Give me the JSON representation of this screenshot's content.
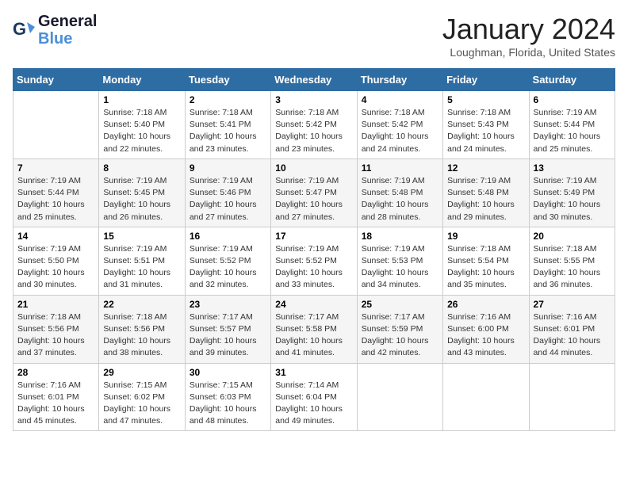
{
  "header": {
    "logo_line1": "General",
    "logo_line2": "Blue",
    "title": "January 2024",
    "subtitle": "Loughman, Florida, United States"
  },
  "days_of_week": [
    "Sunday",
    "Monday",
    "Tuesday",
    "Wednesday",
    "Thursday",
    "Friday",
    "Saturday"
  ],
  "weeks": [
    [
      {
        "day": "",
        "detail": ""
      },
      {
        "day": "1",
        "detail": "Sunrise: 7:18 AM\nSunset: 5:40 PM\nDaylight: 10 hours\nand 22 minutes."
      },
      {
        "day": "2",
        "detail": "Sunrise: 7:18 AM\nSunset: 5:41 PM\nDaylight: 10 hours\nand 23 minutes."
      },
      {
        "day": "3",
        "detail": "Sunrise: 7:18 AM\nSunset: 5:42 PM\nDaylight: 10 hours\nand 23 minutes."
      },
      {
        "day": "4",
        "detail": "Sunrise: 7:18 AM\nSunset: 5:42 PM\nDaylight: 10 hours\nand 24 minutes."
      },
      {
        "day": "5",
        "detail": "Sunrise: 7:18 AM\nSunset: 5:43 PM\nDaylight: 10 hours\nand 24 minutes."
      },
      {
        "day": "6",
        "detail": "Sunrise: 7:19 AM\nSunset: 5:44 PM\nDaylight: 10 hours\nand 25 minutes."
      }
    ],
    [
      {
        "day": "7",
        "detail": "Sunrise: 7:19 AM\nSunset: 5:44 PM\nDaylight: 10 hours\nand 25 minutes."
      },
      {
        "day": "8",
        "detail": "Sunrise: 7:19 AM\nSunset: 5:45 PM\nDaylight: 10 hours\nand 26 minutes."
      },
      {
        "day": "9",
        "detail": "Sunrise: 7:19 AM\nSunset: 5:46 PM\nDaylight: 10 hours\nand 27 minutes."
      },
      {
        "day": "10",
        "detail": "Sunrise: 7:19 AM\nSunset: 5:47 PM\nDaylight: 10 hours\nand 27 minutes."
      },
      {
        "day": "11",
        "detail": "Sunrise: 7:19 AM\nSunset: 5:48 PM\nDaylight: 10 hours\nand 28 minutes."
      },
      {
        "day": "12",
        "detail": "Sunrise: 7:19 AM\nSunset: 5:48 PM\nDaylight: 10 hours\nand 29 minutes."
      },
      {
        "day": "13",
        "detail": "Sunrise: 7:19 AM\nSunset: 5:49 PM\nDaylight: 10 hours\nand 30 minutes."
      }
    ],
    [
      {
        "day": "14",
        "detail": "Sunrise: 7:19 AM\nSunset: 5:50 PM\nDaylight: 10 hours\nand 30 minutes."
      },
      {
        "day": "15",
        "detail": "Sunrise: 7:19 AM\nSunset: 5:51 PM\nDaylight: 10 hours\nand 31 minutes."
      },
      {
        "day": "16",
        "detail": "Sunrise: 7:19 AM\nSunset: 5:52 PM\nDaylight: 10 hours\nand 32 minutes."
      },
      {
        "day": "17",
        "detail": "Sunrise: 7:19 AM\nSunset: 5:52 PM\nDaylight: 10 hours\nand 33 minutes."
      },
      {
        "day": "18",
        "detail": "Sunrise: 7:19 AM\nSunset: 5:53 PM\nDaylight: 10 hours\nand 34 minutes."
      },
      {
        "day": "19",
        "detail": "Sunrise: 7:18 AM\nSunset: 5:54 PM\nDaylight: 10 hours\nand 35 minutes."
      },
      {
        "day": "20",
        "detail": "Sunrise: 7:18 AM\nSunset: 5:55 PM\nDaylight: 10 hours\nand 36 minutes."
      }
    ],
    [
      {
        "day": "21",
        "detail": "Sunrise: 7:18 AM\nSunset: 5:56 PM\nDaylight: 10 hours\nand 37 minutes."
      },
      {
        "day": "22",
        "detail": "Sunrise: 7:18 AM\nSunset: 5:56 PM\nDaylight: 10 hours\nand 38 minutes."
      },
      {
        "day": "23",
        "detail": "Sunrise: 7:17 AM\nSunset: 5:57 PM\nDaylight: 10 hours\nand 39 minutes."
      },
      {
        "day": "24",
        "detail": "Sunrise: 7:17 AM\nSunset: 5:58 PM\nDaylight: 10 hours\nand 41 minutes."
      },
      {
        "day": "25",
        "detail": "Sunrise: 7:17 AM\nSunset: 5:59 PM\nDaylight: 10 hours\nand 42 minutes."
      },
      {
        "day": "26",
        "detail": "Sunrise: 7:16 AM\nSunset: 6:00 PM\nDaylight: 10 hours\nand 43 minutes."
      },
      {
        "day": "27",
        "detail": "Sunrise: 7:16 AM\nSunset: 6:01 PM\nDaylight: 10 hours\nand 44 minutes."
      }
    ],
    [
      {
        "day": "28",
        "detail": "Sunrise: 7:16 AM\nSunset: 6:01 PM\nDaylight: 10 hours\nand 45 minutes."
      },
      {
        "day": "29",
        "detail": "Sunrise: 7:15 AM\nSunset: 6:02 PM\nDaylight: 10 hours\nand 47 minutes."
      },
      {
        "day": "30",
        "detail": "Sunrise: 7:15 AM\nSunset: 6:03 PM\nDaylight: 10 hours\nand 48 minutes."
      },
      {
        "day": "31",
        "detail": "Sunrise: 7:14 AM\nSunset: 6:04 PM\nDaylight: 10 hours\nand 49 minutes."
      },
      {
        "day": "",
        "detail": ""
      },
      {
        "day": "",
        "detail": ""
      },
      {
        "day": "",
        "detail": ""
      }
    ]
  ]
}
